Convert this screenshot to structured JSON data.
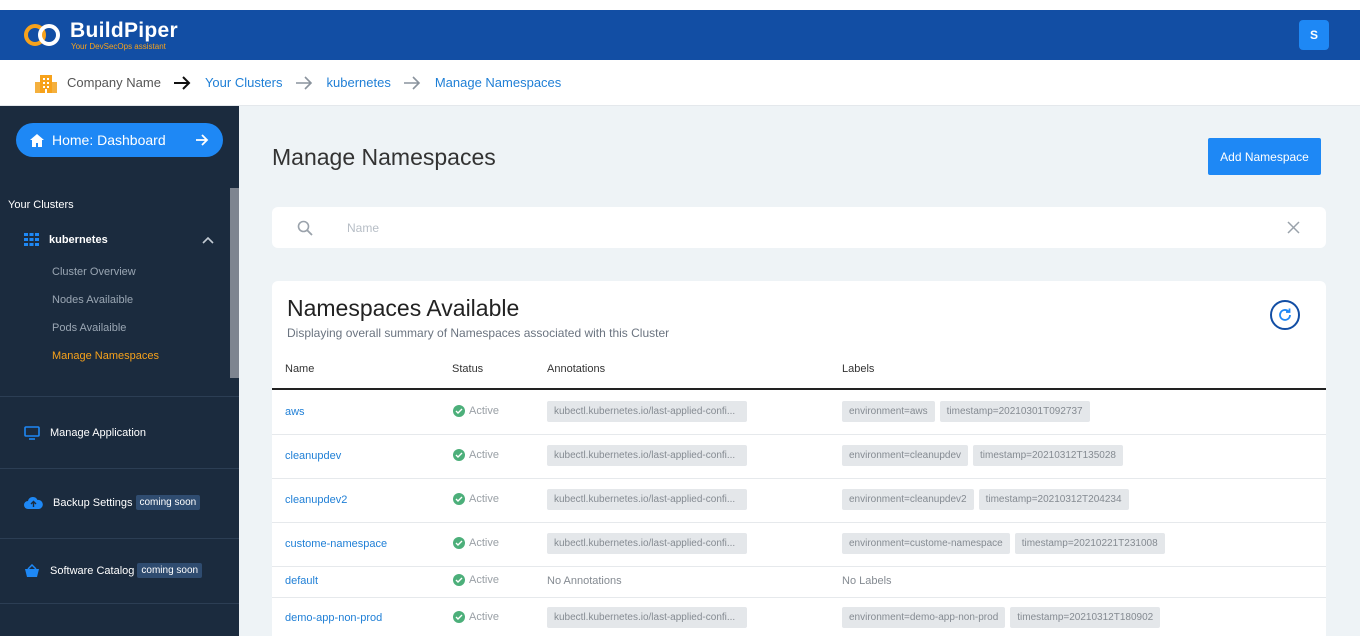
{
  "header": {
    "brand": "BuildPiper",
    "tagline": "Your DevSecOps assistant",
    "avatar": "S"
  },
  "breadcrumb": {
    "company": "Company Name",
    "items": [
      "Your Clusters",
      "kubernetes",
      "Manage Namespaces"
    ]
  },
  "sidebar": {
    "home": "Home: Dashboard",
    "section": "Your Clusters",
    "cluster": "kubernetes",
    "sub_items": [
      "Cluster Overview",
      "Nodes Availaible",
      "Pods Availaible",
      "Manage Namespaces"
    ],
    "items": [
      {
        "label": "Manage Application"
      },
      {
        "label": "Backup Settings",
        "badge": "coming soon"
      },
      {
        "label": "Software Catalog",
        "badge": "coming soon"
      }
    ]
  },
  "main": {
    "title": "Manage Namespaces",
    "add_button": "Add Namespace",
    "search_placeholder": "Name",
    "card_title": "Namespaces Available",
    "card_subtitle": "Displaying overall summary of Namespaces associated with this Cluster",
    "columns": [
      "Name",
      "Status",
      "Annotations",
      "Labels"
    ],
    "rows": [
      {
        "name": "aws",
        "status": "Active",
        "annotation": "kubectl.kubernetes.io/last-applied-confi...",
        "labels": [
          "environment=aws",
          "timestamp=20210301T092737"
        ]
      },
      {
        "name": "cleanupdev",
        "status": "Active",
        "annotation": "kubectl.kubernetes.io/last-applied-confi...",
        "labels": [
          "environment=cleanupdev",
          "timestamp=20210312T135028"
        ]
      },
      {
        "name": "cleanupdev2",
        "status": "Active",
        "annotation": "kubectl.kubernetes.io/last-applied-confi...",
        "labels": [
          "environment=cleanupdev2",
          "timestamp=20210312T204234"
        ]
      },
      {
        "name": "custome-namespace",
        "status": "Active",
        "annotation": "kubectl.kubernetes.io/last-applied-confi...",
        "labels": [
          "environment=custome-namespace",
          "timestamp=20210221T231008"
        ]
      },
      {
        "name": "default",
        "status": "Active",
        "annotation_text": "No Annotations",
        "labels_text": "No Labels"
      },
      {
        "name": "demo-app-non-prod",
        "status": "Active",
        "annotation": "kubectl.kubernetes.io/last-applied-confi...",
        "labels": [
          "environment=demo-app-non-prod",
          "timestamp=20210312T180902"
        ]
      }
    ]
  },
  "colors": {
    "header_bg": "#124ea4",
    "accent": "#1e88f5",
    "sidebar_bg": "#1b2b3e",
    "active_item": "#f7a21b",
    "status_ok": "#4caf7a"
  }
}
